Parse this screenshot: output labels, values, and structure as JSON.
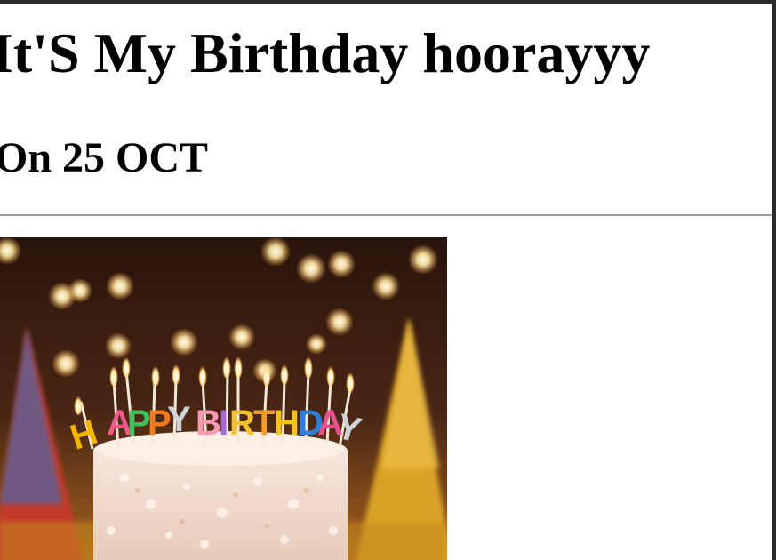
{
  "heading": "It'S My Birthday hoorayyy",
  "subheading": "On 25 OCT",
  "image": {
    "subject": "birthday cake with candles",
    "candle_letters": [
      "H",
      "A",
      "P",
      "P",
      "Y",
      "B",
      "I",
      "R",
      "T",
      "H",
      "D",
      "A",
      "Y"
    ]
  }
}
